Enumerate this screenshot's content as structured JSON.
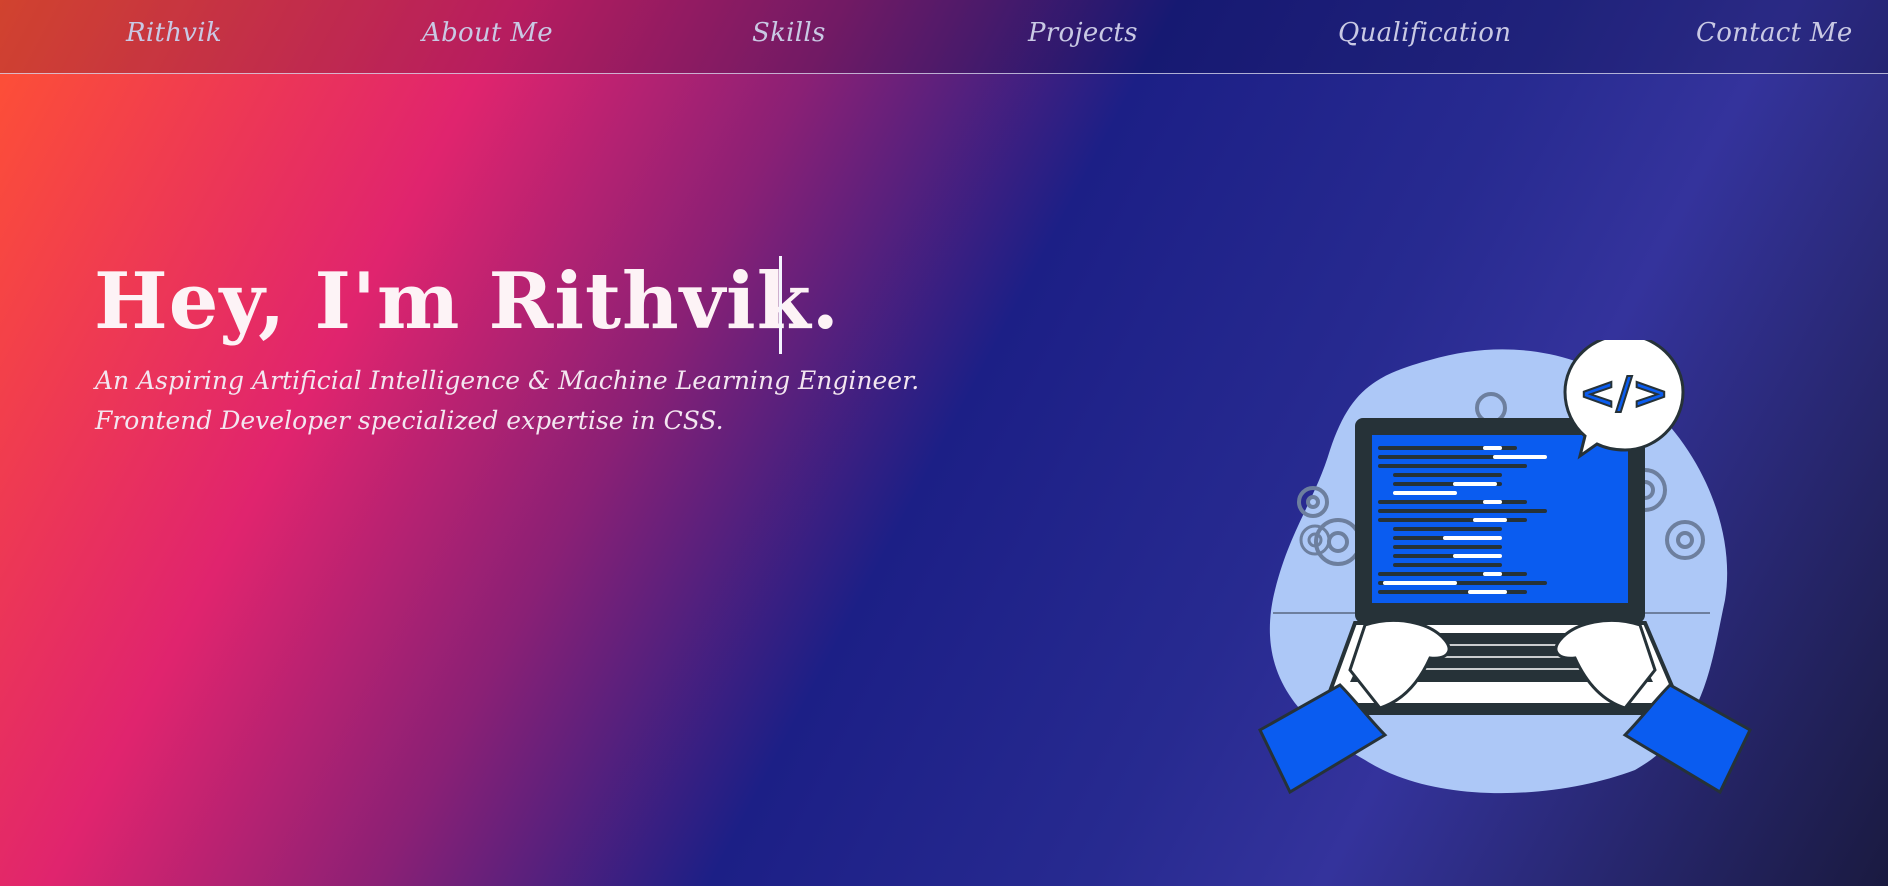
{
  "nav": {
    "brand": "Rithvik",
    "items": [
      {
        "label": "About Me"
      },
      {
        "label": "Skills"
      },
      {
        "label": "Projects"
      },
      {
        "label": "Qualification"
      },
      {
        "label": "Contact Me"
      }
    ]
  },
  "hero": {
    "title": "Hey, I'm Rithvik.",
    "subtitle_line1": "An Aspiring Artificial Intelligence & Machine Learning Engineer.",
    "subtitle_line2": "Frontend Developer specialized expertise in CSS."
  },
  "illustration": {
    "icon": "laptop-coding-icon",
    "bubble_icon": "code-tag-icon",
    "bubble_text": "</>",
    "colors": {
      "blob": "#adc8f7",
      "screen": "#0a5cf0",
      "sleeve": "#0a5cf0",
      "frame": "#263238"
    }
  },
  "colors": {
    "gradient_start": "#ff5233",
    "gradient_pink": "#e0246e",
    "gradient_blue": "#1c1f86",
    "gradient_end": "#1a1a40",
    "nav_text": "#c9c9e4"
  }
}
